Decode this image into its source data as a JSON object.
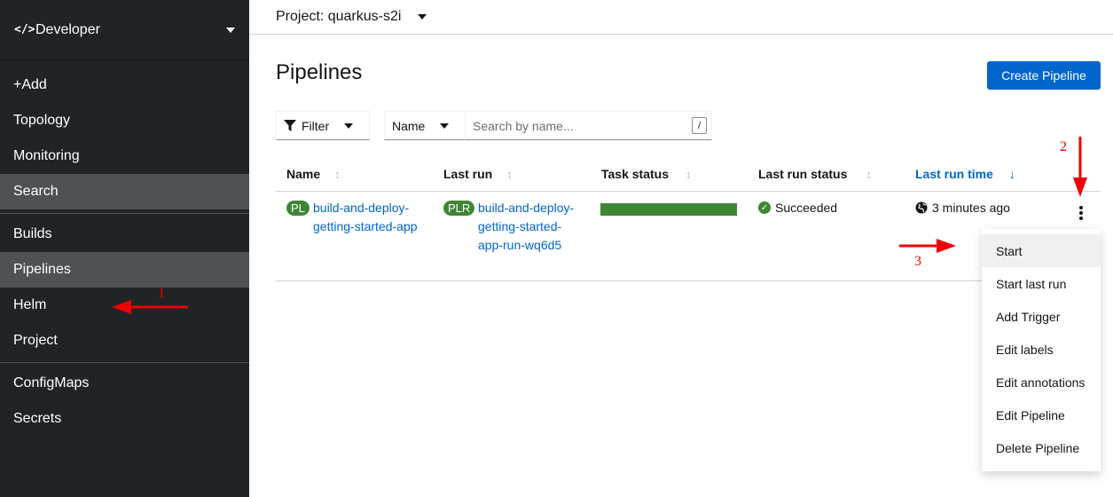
{
  "sidebar": {
    "perspective": {
      "icon": "code-icon",
      "label": "Developer"
    },
    "groups": [
      [
        {
          "label": "+Add"
        },
        {
          "label": "Topology"
        },
        {
          "label": "Monitoring"
        },
        {
          "label": "Search",
          "active": true
        }
      ],
      [
        {
          "label": "Builds"
        },
        {
          "label": "Pipelines",
          "active": true
        },
        {
          "label": "Helm"
        },
        {
          "label": "Project"
        }
      ],
      [
        {
          "label": "ConfigMaps"
        },
        {
          "label": "Secrets"
        }
      ]
    ]
  },
  "topbar": {
    "project_label": "Project: quarkus-s2i"
  },
  "page": {
    "title": "Pipelines",
    "create_button": "Create Pipeline"
  },
  "toolbar": {
    "filter_label": "Filter",
    "name_select": "Name",
    "search_placeholder": "Search by name...",
    "shortcut_key": "/"
  },
  "table": {
    "columns": {
      "name": "Name",
      "last_run": "Last run",
      "task_status": "Task status",
      "last_run_status": "Last run status",
      "last_run_time": "Last run time"
    },
    "row": {
      "pl_badge": "PL",
      "name": "build-and-deploy-getting-started-app",
      "plr_badge": "PLR",
      "last_run": "build-and-deploy-getting-started-app-run-wq6d5",
      "task_status_succeeded_fraction": 1.0,
      "status": "Succeeded",
      "time": "3 minutes ago"
    }
  },
  "menu": {
    "items": [
      "Start",
      "Start last run",
      "Add Trigger",
      "Edit labels",
      "Edit annotations",
      "Edit Pipeline",
      "Delete Pipeline"
    ]
  },
  "annotations": {
    "n1": "1",
    "n2": "2",
    "n3": "3"
  },
  "colors": {
    "accent": "#0066cc",
    "success": "#3e8635",
    "sidebar": "#212427",
    "annotation": "#ee0000"
  }
}
